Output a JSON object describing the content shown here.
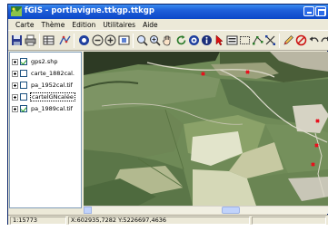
{
  "window": {
    "title": "fGIS - portlavigne.ttkgp.ttkgp"
  },
  "menu": [
    "Carte",
    "Thème",
    "Edition",
    "Utilitaires",
    "Aide"
  ],
  "toolbar": [
    "save-icon",
    "print-icon",
    "table-icon",
    "vector-icon",
    "zoom-full-icon",
    "zoom-out-icon",
    "zoom-in-icon",
    "zoom-layer-icon",
    "zoom-rect-icon",
    "zoom-plus-icon",
    "pan-hand-icon",
    "refresh-icon",
    "target-icon",
    "info-icon",
    "select-arrow-icon",
    "layer-list-icon",
    "rectangle-select-icon",
    "edit-vertices-icon",
    "node-tool-icon",
    "pencil-icon",
    "no-entry-icon",
    "undo-icon",
    "redo-icon"
  ],
  "layers": [
    {
      "name": "gps2.shp",
      "checked": true,
      "selected": false
    },
    {
      "name": "carte_1882cal.",
      "checked": false,
      "selected": false
    },
    {
      "name": "pa_1952cal.tif",
      "checked": false,
      "selected": false
    },
    {
      "name": "cartelGNcalée",
      "checked": false,
      "selected": true
    },
    {
      "name": "pa_1989cal.tif",
      "checked": true,
      "selected": false
    }
  ],
  "map": {
    "gps_points": [
      {
        "id": "p1",
        "color": "#e8101c"
      },
      {
        "id": "p2",
        "color": "#e8101c"
      },
      {
        "id": "p3",
        "color": "#e8101c"
      },
      {
        "id": "p4",
        "color": "#e8101c"
      },
      {
        "id": "p5",
        "color": "#e8101c"
      }
    ]
  },
  "status": {
    "scale": "1:15773",
    "coords": "X:602935,7282 Y:5226697,4636"
  }
}
